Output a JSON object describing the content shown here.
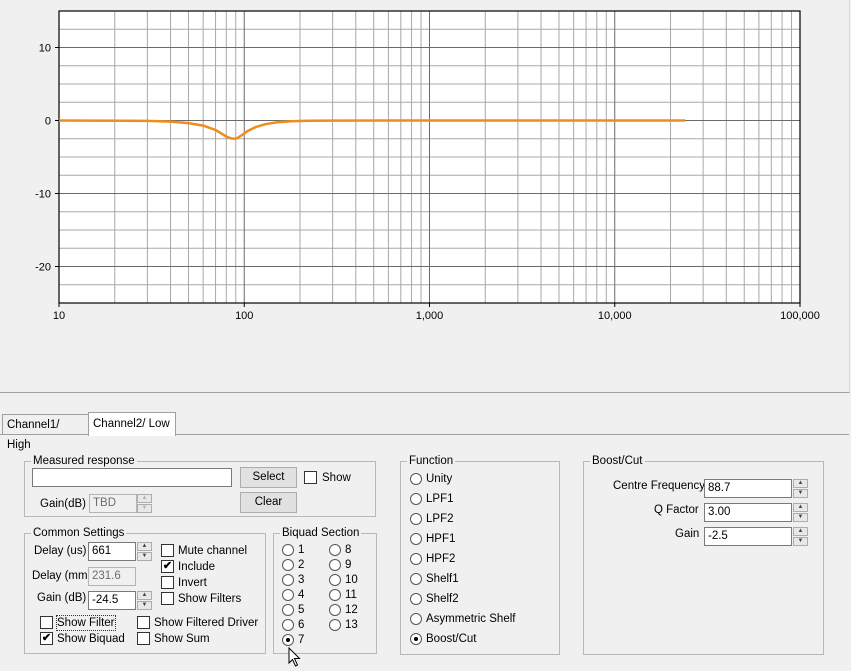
{
  "chart_data": {
    "type": "line",
    "title": "",
    "xlabel": "",
    "ylabel": "",
    "x_scale": "log",
    "xlim": [
      10,
      100000
    ],
    "ylim": [
      -25,
      15
    ],
    "x_ticks": [
      "10",
      "100",
      "1,000",
      "10,000",
      "100,000"
    ],
    "y_ticks": [
      "10",
      "0",
      "-10",
      "-20"
    ],
    "grid": true,
    "series": [
      {
        "color": "#f08c1e",
        "x": [
          10,
          30,
          40,
          50,
          60,
          70,
          75,
          80,
          85,
          88.7,
          92,
          97,
          105,
          115,
          130,
          150,
          180,
          220,
          280,
          1000,
          10000,
          24000
        ],
        "y": [
          0,
          -0.05,
          -0.15,
          -0.35,
          -0.7,
          -1.3,
          -1.75,
          -2.2,
          -2.45,
          -2.5,
          -2.4,
          -2.0,
          -1.4,
          -0.9,
          -0.5,
          -0.25,
          -0.1,
          -0.04,
          -0.01,
          0,
          0,
          0
        ]
      }
    ]
  },
  "tabs": [
    {
      "label": "Channel1/ High"
    },
    {
      "label": "Channel2/ Low"
    }
  ],
  "measured": {
    "title": "Measured response",
    "file_value": "",
    "select_label": "Select",
    "show_label": "Show",
    "show_checked": false,
    "gain_label": "Gain(dB)",
    "gain_value": "TBD",
    "clear_label": "Clear"
  },
  "common": {
    "title": "Common Settings",
    "delay_us_label": "Delay (us)",
    "delay_us_value": "661",
    "delay_mm_label": "Delay (mm)",
    "delay_mm_value": "231.6",
    "gain_label": "Gain (dB)",
    "gain_value": "-24.5",
    "mute_label": "Mute channel",
    "mute_checked": false,
    "include_label": "Include",
    "include_checked": true,
    "invert_label": "Invert",
    "invert_checked": false,
    "show_filters_label": "Show Filters",
    "show_filters_checked": false,
    "show_filter_label": "Show Filter",
    "show_filter_checked": false,
    "show_filtered_driver_label": "Show Filtered Driver",
    "show_filtered_driver_checked": false,
    "show_biquad_label": "Show Biquad",
    "show_biquad_checked": true,
    "show_sum_label": "Show Sum",
    "show_sum_checked": false
  },
  "biquad": {
    "title": "Biquad Section",
    "options": [
      "1",
      "2",
      "3",
      "4",
      "5",
      "6",
      "7",
      "8",
      "9",
      "10",
      "11",
      "12",
      "13"
    ],
    "selected": "7"
  },
  "function": {
    "title": "Function",
    "options": [
      "Unity",
      "LPF1",
      "LPF2",
      "HPF1",
      "HPF2",
      "Shelf1",
      "Shelf2",
      "Asymmetric Shelf",
      "Boost/Cut"
    ],
    "selected": "Boost/Cut"
  },
  "boostcut": {
    "title": "Boost/Cut",
    "centre_label": "Centre Frequency",
    "centre_value": "88.7",
    "q_label": "Q Factor",
    "q_value": "3.00",
    "gain_label": "Gain",
    "gain_value": "-2.5"
  },
  "check_mark": "✔",
  "spin_up": "▲",
  "spin_down": "▼"
}
